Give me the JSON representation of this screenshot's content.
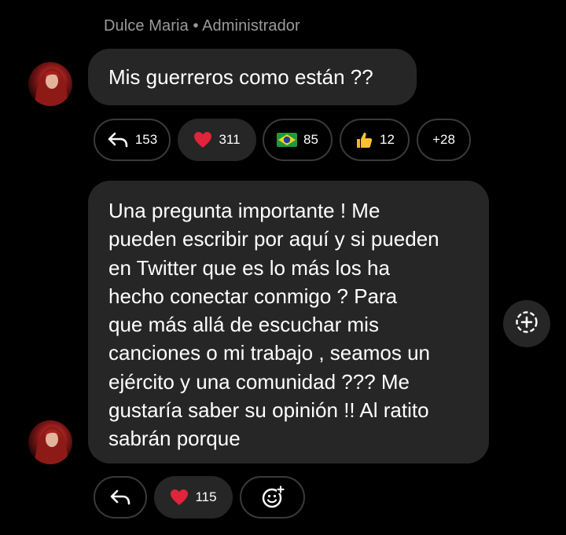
{
  "header": {
    "sender": "Dulce Maria • Administrador"
  },
  "message1": {
    "text": "Mis guerreros como están ??",
    "reactions": [
      {
        "icon": "reply-icon",
        "count": "153"
      },
      {
        "icon": "heart-icon",
        "count": "311"
      },
      {
        "icon": "brazil-flag-icon",
        "count": "85"
      },
      {
        "icon": "thumbs-up-icon",
        "count": "12"
      },
      {
        "icon": "",
        "count": "+28"
      }
    ]
  },
  "message2": {
    "text": "Una pregunta importante ! Me\npueden escribir por aquí y si pueden\nen Twitter que es lo más los ha\nhecho conectar conmigo ? Para\nque más allá de escuchar mis\ncanciones o mi trabajo , seamos un\nejército y una comunidad ??? Me\ngustaría saber su opinión !! Al ratito\nsabrán porque",
    "reactions": [
      {
        "icon": "reply-icon",
        "count": ""
      },
      {
        "icon": "heart-icon",
        "count": "115"
      },
      {
        "icon": "add-reaction-icon",
        "count": ""
      }
    ]
  },
  "colors": {
    "background": "#000000",
    "bubble": "#262626",
    "chip_border": "#3a3a3a",
    "meta_text": "#9a9a9a",
    "heart": "#e0243a"
  }
}
